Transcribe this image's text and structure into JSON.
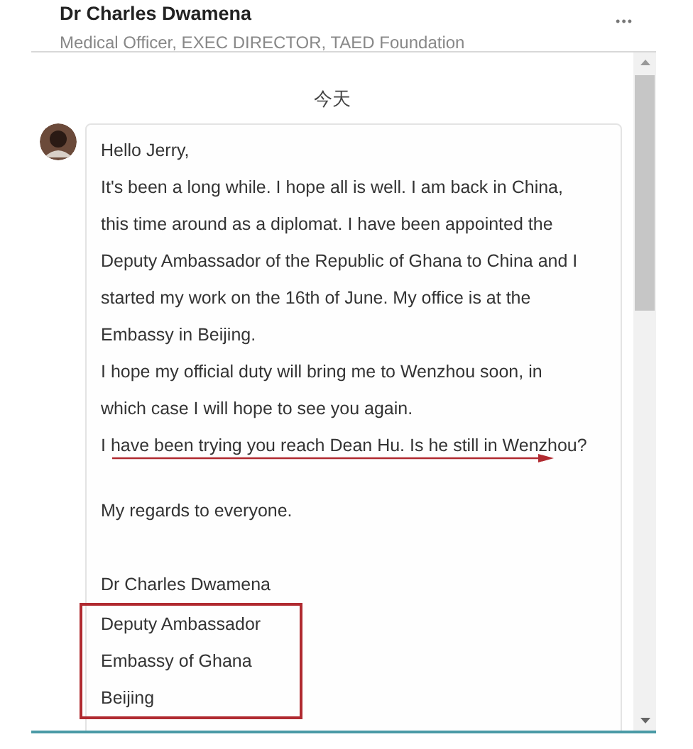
{
  "header": {
    "name": "Dr Charles Dwamena",
    "headline": "Medical Officer, EXEC DIRECTOR, TAED Foundation",
    "menu": "•••"
  },
  "day_label": "今天",
  "message": {
    "blocks": [
      {
        "kind": "paragraph",
        "lines": [
          {
            "text": "Hello Jerry,",
            "arrow": false
          },
          {
            "text": "It's been a long while. I hope all is well. I am back in China,",
            "arrow": false
          },
          {
            "text": "this time around as a diplomat. I have been appointed the",
            "arrow": false
          },
          {
            "text": "Deputy Ambassador of the Republic of Ghana to China and I",
            "arrow": false
          },
          {
            "text": "started my work on the 16th of June. My office is at the",
            "arrow": false
          },
          {
            "text": "Embassy in Beijing.",
            "arrow": false
          },
          {
            "text": "I hope my official duty will bring me to Wenzhou soon, in",
            "arrow": false
          },
          {
            "text": "which case I will hope to see you again.",
            "arrow": false
          },
          {
            "text": "I have been trying you reach Dean Hu. Is he still in Wenzhou?",
            "arrow": true
          }
        ]
      },
      {
        "kind": "paragraph",
        "lines": [
          {
            "text": "My regards to everyone.",
            "arrow": false
          }
        ]
      },
      {
        "kind": "paragraph",
        "lines": [
          {
            "text": "Dr Charles Dwamena",
            "arrow": false
          }
        ]
      },
      {
        "kind": "boxed",
        "lines": [
          {
            "text": "Deputy Ambassador",
            "arrow": false
          },
          {
            "text": "Embassy of Ghana",
            "arrow": false
          },
          {
            "text": "Beijing",
            "arrow": false
          }
        ]
      }
    ]
  }
}
